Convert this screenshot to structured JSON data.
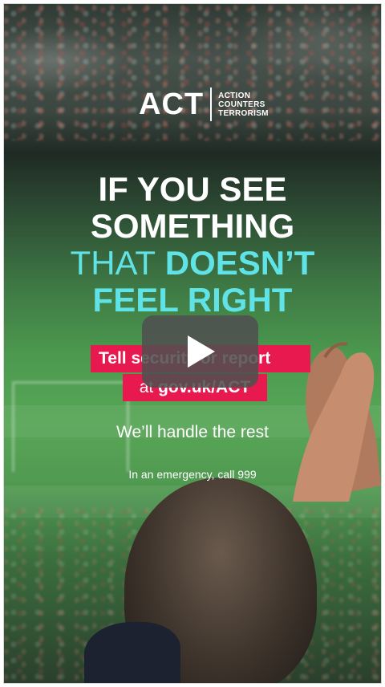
{
  "video": {
    "logo": {
      "wordmark": "ACT",
      "subtitle_lines": [
        "ACTION",
        "COUNTERS",
        "TERRORISM"
      ]
    },
    "headline": {
      "line1": "IF YOU SEE",
      "line2": "SOMETHING",
      "line3_light": "THAT",
      "line3_bold": "DOESN’T",
      "line4": "FEEL RIGHT"
    },
    "cta": {
      "line1": "Tell security or report",
      "line2_prefix": "at",
      "line2_link": "gov.uk/ACT"
    },
    "tagline": "We’ll handle the rest",
    "emergency": "In an emergency, call 999",
    "play_button_icon": "play-icon",
    "colors": {
      "accent_cyan": "#5fe3e6",
      "accent_pink": "#e8194f",
      "play_bg": "#505050"
    }
  }
}
